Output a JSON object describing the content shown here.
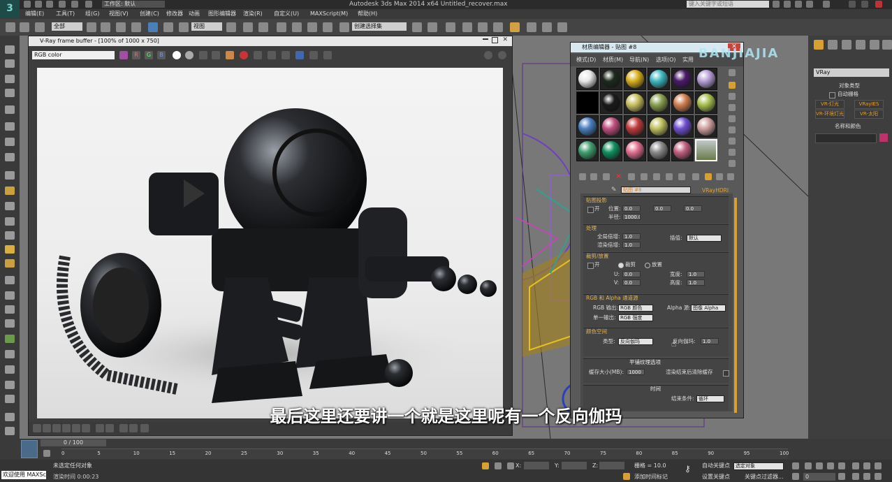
{
  "app": {
    "title": "Autodesk 3ds Max  2014 x64      Untitled_recover.max",
    "workspace": "工作区: 默认",
    "search_placeholder": "键入关键字或短语"
  },
  "menu": [
    "编辑(E)",
    "工具(T)",
    "组(G)",
    "视图(V)",
    "创建(C)",
    "修改器",
    "动画",
    "图形编辑器",
    "渲染(R)",
    "自定义(U)",
    "MAXScript(M)",
    "帮助(H)"
  ],
  "toolbar": {
    "selection_filter": "全部",
    "ref_coord": "视图",
    "named_set": "创建选择集"
  },
  "vfb": {
    "title": "V-Ray frame buffer - [100% of 1000 x 750]",
    "channel": "RGB color",
    "rgb_buttons": [
      "R",
      "G",
      "B"
    ]
  },
  "med": {
    "title": "材质编辑器 - 贴图 #8",
    "menu": [
      "模式(D)",
      "材质(M)",
      "导航(N)",
      "选项(O)",
      "实用"
    ],
    "map_name": "贴图 #8",
    "map_type": "VRayHDRI",
    "mapping_header": "贴图投影",
    "on_label": "开",
    "pos_label": "位置:",
    "pos_values": [
      "0.0",
      "0.0",
      "0.0"
    ],
    "radius_label": "半径:",
    "radius_value": "1000.0",
    "processing_header": "处理",
    "overall_mult_label": "全局倍增:",
    "overall_mult": "1.0",
    "render_mult_label": "渲染倍增:",
    "render_mult": "1.0",
    "interp_label": "插值:",
    "interp_value": "默认",
    "crop_header": "裁剪/放置",
    "crop_on": "开",
    "crop_label": "裁剪",
    "place_label": "放置",
    "u_label": "U:",
    "u_value": "0.0",
    "v_label": "V:",
    "v_value": "0.0",
    "w_label": "宽度:",
    "w_value": "1.0",
    "h_label": "高度:",
    "h_value": "1.0",
    "rgb_alpha_header": "RGB 和 Alpha 通道源",
    "rgb_out_label": "RGB 输出:",
    "rgb_out": "RGB 颜色",
    "alpha_src_label": "Alpha 源:",
    "alpha_src": "图像 Alpha",
    "mono_out_label": "单一输出:",
    "mono_out": "RGB 强度",
    "colorspace_header": "颜色空间",
    "type_label": "类型:",
    "type_value": "反向伽玛",
    "inv_gamma_label": "反向伽玛:",
    "inv_gamma": "1.0",
    "tiled_header": "平铺纹理选项",
    "cache_label": "缓存大小(MB):",
    "cache_value": "1000",
    "clear_cache_label": "渲染结束后清除缓存",
    "time_header": "时间",
    "end_cond_label": "结束条件:",
    "end_cond": "循环"
  },
  "cmd": {
    "renderer": "VRay",
    "object_type_header": "对象类型",
    "autogrid": "自动栅格",
    "buttons": [
      "VR-灯光",
      "VRayIES",
      "VR-环境灯光",
      "VR-太阳"
    ],
    "name_color_header": "名称和颜色",
    "accent_color": "#c0306a"
  },
  "timeline": {
    "frame": "0 / 100",
    "ticks": [
      "0",
      "5",
      "10",
      "15",
      "20",
      "25",
      "30",
      "35",
      "40",
      "45",
      "50",
      "55",
      "60",
      "65",
      "70",
      "75",
      "80",
      "85",
      "90",
      "95",
      "100"
    ]
  },
  "status": {
    "welcome": "欢迎使用 MAXSc",
    "selection": "未选定任何对象",
    "render_time": "渲染时间  0:00:23",
    "x_label": "X:",
    "y_label": "Y:",
    "z_label": "Z:",
    "grid": "栅格 = 10.0",
    "add_time_tag": "添加时间标记",
    "auto_key": "自动关键点",
    "set_key": "设置关键点",
    "selected_obj": "选定对象",
    "key_filters": "关键点过滤器...",
    "frame_field": "0"
  },
  "subtitle": "最后这里还要讲一个就是这里呢有一个反向伽玛",
  "watermark": "BANJIAJIA"
}
